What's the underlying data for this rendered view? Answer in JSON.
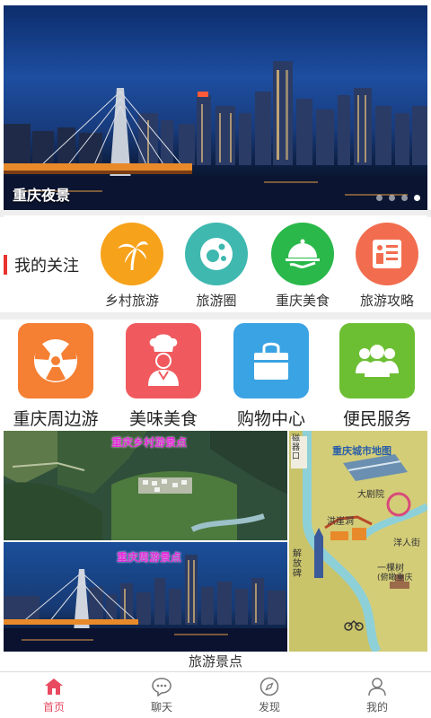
{
  "banner": {
    "caption": "重庆夜景",
    "slide_count": 4,
    "active_slide": 4
  },
  "focus": {
    "label": "我的关注",
    "items": [
      {
        "label": "乡村旅游",
        "color": "#f7a21b",
        "icon": "palm-tree-icon"
      },
      {
        "label": "旅游圈",
        "color": "#3fb8b0",
        "icon": "bubbles-icon"
      },
      {
        "label": "重庆美食",
        "color": "#2ab84a",
        "icon": "food-cloche-icon"
      },
      {
        "label": "旅游攻略",
        "color": "#f26d4f",
        "icon": "list-document-icon"
      }
    ]
  },
  "tiles": [
    {
      "label": "重庆周边游",
      "color": "#f57f33",
      "icon": "radiation-icon"
    },
    {
      "label": "美味美食",
      "color": "#f05a5e",
      "icon": "chef-icon"
    },
    {
      "label": "购物中心",
      "color": "#3aa3e3",
      "icon": "shopping-bag-icon"
    },
    {
      "label": "便民服务",
      "color": "#6cbf33",
      "icon": "people-icon"
    }
  ],
  "photos": {
    "village_title": "重庆乡村游景点",
    "city_title": "重庆周游景点",
    "map_title": "重庆城市地图",
    "map_labels": [
      "磁器口",
      "大剧院",
      "洪崖洞",
      "洋人街",
      "解放碑",
      "一棵树",
      "(俯瞰重庆"
    ]
  },
  "section_label": "旅游景点",
  "tabbar": {
    "items": [
      {
        "label": "首页",
        "icon": "home-icon",
        "active": true
      },
      {
        "label": "聊天",
        "icon": "chat-icon",
        "active": false
      },
      {
        "label": "发现",
        "icon": "compass-icon",
        "active": false
      },
      {
        "label": "我的",
        "icon": "user-icon",
        "active": false
      }
    ]
  },
  "colors": {
    "accent": "#e84a5f",
    "focus_bar": "#e8322e"
  }
}
